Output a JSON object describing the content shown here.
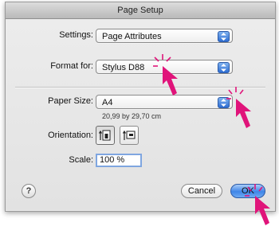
{
  "window": {
    "title": "Page Setup"
  },
  "settings": {
    "label": "Settings:",
    "value": "Page Attributes"
  },
  "format_for": {
    "label": "Format for:",
    "value": "Stylus D88"
  },
  "paper_size": {
    "label": "Paper Size:",
    "value": "A4",
    "dimensions": "20,99 by 29,70 cm"
  },
  "orientation": {
    "label": "Orientation:"
  },
  "scale": {
    "label": "Scale:",
    "value": "100 %"
  },
  "help": {
    "label": "?"
  },
  "buttons": {
    "cancel": "Cancel",
    "ok": "OK"
  },
  "colors": {
    "popup_arrow": "#2e6ed3",
    "cursor": "#e0147a",
    "default_button": "#3f86e8"
  },
  "annotations": {
    "cursor_icon": "magenta-arrow-cursor-icon"
  }
}
